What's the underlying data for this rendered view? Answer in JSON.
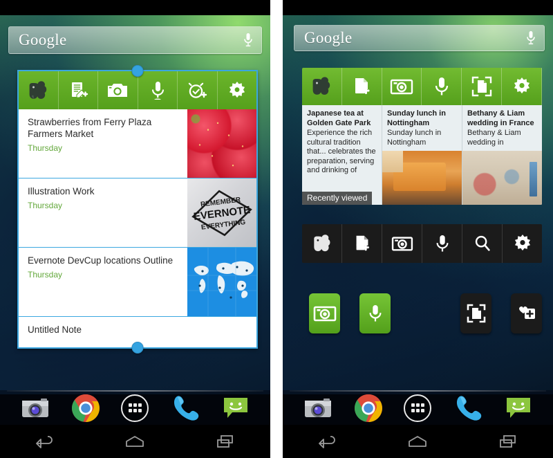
{
  "screens": [
    {
      "id": "left-home-screen",
      "search_widget": {
        "logo": "Google",
        "mic_icon": "microphone-icon"
      },
      "evernote_list_widget": {
        "toolbar": [
          {
            "name": "evernote-elephant-icon",
            "label": "Evernote"
          },
          {
            "name": "new-note-icon",
            "label": "New Note"
          },
          {
            "name": "camera-icon",
            "label": "Snapshot"
          },
          {
            "name": "microphone-icon",
            "label": "Audio Note"
          },
          {
            "name": "reminder-alarm-icon",
            "label": "Reminder"
          },
          {
            "name": "gear-icon",
            "label": "Settings"
          }
        ],
        "notes": [
          {
            "title": "Strawberries from Ferry Plaza Farmers Market",
            "date": "Thursday",
            "thumb": "strawberries-photo"
          },
          {
            "title": "Illustration Work",
            "date": "Thursday",
            "thumb": "evernote-illustration",
            "thumb_text": [
              "REMEMBER",
              "EVERNOTE",
              "EVERYTHING"
            ]
          },
          {
            "title": "Evernote DevCup locations Outline",
            "date": "Thursday",
            "thumb": "world-map-image"
          },
          {
            "title": "Untitled Note",
            "date": "",
            "thumb": ""
          }
        ],
        "resize_handles": [
          "top-resize-handle",
          "bottom-resize-handle"
        ]
      },
      "dock": [
        {
          "name": "camera-app-icon",
          "label": "Camera"
        },
        {
          "name": "chrome-app-icon",
          "label": "Chrome"
        },
        {
          "name": "app-drawer-icon",
          "label": "Apps"
        },
        {
          "name": "phone-app-icon",
          "label": "Phone"
        },
        {
          "name": "messaging-app-icon",
          "label": "Messaging"
        }
      ],
      "navbar": [
        {
          "name": "back-nav-button",
          "label": "Back"
        },
        {
          "name": "home-nav-button",
          "label": "Home"
        },
        {
          "name": "recents-nav-button",
          "label": "Recents"
        }
      ]
    },
    {
      "id": "right-home-screen",
      "search_widget": {
        "logo": "Google",
        "mic_icon": "microphone-icon"
      },
      "evernote_cards_widget": {
        "toolbar": [
          {
            "name": "evernote-elephant-icon",
            "label": "Evernote"
          },
          {
            "name": "new-note-icon",
            "label": "New Note"
          },
          {
            "name": "camera-icon",
            "label": "Snapshot"
          },
          {
            "name": "microphone-icon",
            "label": "Audio Note"
          },
          {
            "name": "page-camera-icon",
            "label": "Page Camera"
          },
          {
            "name": "gear-icon",
            "label": "Settings"
          }
        ],
        "badge": "Recently viewed",
        "cards": [
          {
            "title": "Japanese tea at Golden Gate Park",
            "snippet": "Experience the rich cultural tradition that... celebrates the preparation, serving and drinking of",
            "thumb": ""
          },
          {
            "title": "Sunday lunch in Nottingham",
            "snippet": "Sunday lunch in Nottingham",
            "thumb": "cake-photo"
          },
          {
            "title": "Bethany & Liam wedding in France",
            "snippet": "Bethany & Liam wedding in",
            "thumb": "wedding-table-photo"
          }
        ]
      },
      "evernote_black_toolbar": [
        {
          "name": "evernote-elephant-icon",
          "label": "Evernote"
        },
        {
          "name": "new-note-icon",
          "label": "New Note"
        },
        {
          "name": "camera-icon",
          "label": "Snapshot"
        },
        {
          "name": "microphone-icon",
          "label": "Audio Note"
        },
        {
          "name": "search-icon",
          "label": "Search"
        },
        {
          "name": "gear-icon",
          "label": "Settings"
        }
      ],
      "shortcuts": [
        {
          "name": "camera-shortcut-icon",
          "label": "Snapshot",
          "style": "green"
        },
        {
          "name": "microphone-shortcut-icon",
          "label": "Audio",
          "style": "green"
        },
        {
          "name": "page-camera-shortcut-icon",
          "label": "Page Camera",
          "style": "black"
        },
        {
          "name": "add-favorite-shortcut-icon",
          "label": "Add Favorite",
          "style": "black"
        }
      ],
      "dock": [
        {
          "name": "camera-app-icon",
          "label": "Camera"
        },
        {
          "name": "chrome-app-icon",
          "label": "Chrome"
        },
        {
          "name": "app-drawer-icon",
          "label": "Apps"
        },
        {
          "name": "phone-app-icon",
          "label": "Phone"
        },
        {
          "name": "messaging-app-icon",
          "label": "Messaging"
        }
      ],
      "navbar": [
        {
          "name": "back-nav-button",
          "label": "Back"
        },
        {
          "name": "home-nav-button",
          "label": "Home"
        },
        {
          "name": "recents-nav-button",
          "label": "Recents"
        }
      ]
    }
  ],
  "colors": {
    "evernote_green": "#5aa81e",
    "evernote_green_light": "#76c436",
    "note_date_green": "#63a83b",
    "widget_selection_blue": "#3ba7e0",
    "toolbar_black": "#1b1b1b"
  }
}
